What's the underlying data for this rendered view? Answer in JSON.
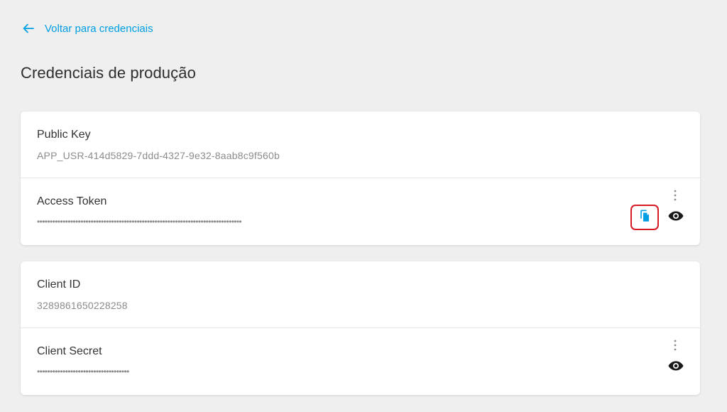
{
  "back_link": {
    "label": "Voltar para credenciais",
    "icon": "arrow-left-icon"
  },
  "page_title": "Credenciais de produção",
  "colors": {
    "accent": "#009ee3",
    "highlight": "#d81b22",
    "background": "#efefef",
    "card": "#ffffff"
  },
  "cards": [
    {
      "rows": [
        {
          "label": "Public Key",
          "value": "APP_USR-414d5829-7ddd-4327-9e32-8aab8c9f560b"
        },
        {
          "label": "Access Token",
          "masked_value": "••••••••••••••••••••••••••••••••••••••••••••••••••••••••••••••••••••••••••••••••",
          "actions": [
            "more-vertical-icon",
            "copy-icon",
            "eye-icon"
          ]
        }
      ]
    },
    {
      "rows": [
        {
          "label": "Client ID",
          "value": "3289861650228258"
        },
        {
          "label": "Client Secret",
          "masked_value": "••••••••••••••••••••••••••••••••••••",
          "actions": [
            "more-vertical-icon",
            "eye-icon"
          ]
        }
      ]
    }
  ]
}
